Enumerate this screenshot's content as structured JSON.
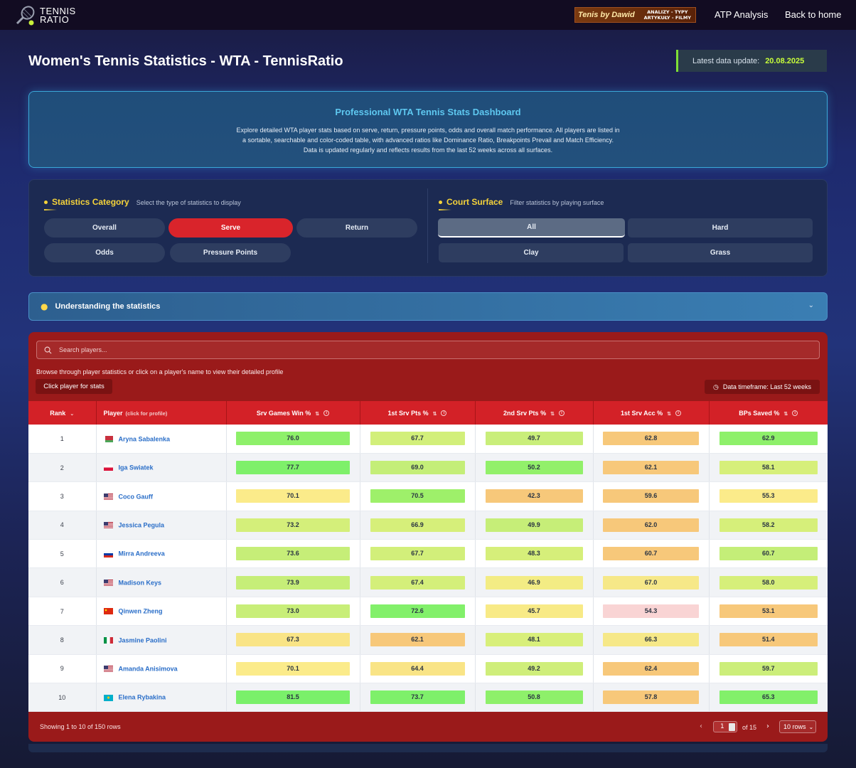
{
  "nav": {
    "brand_line1": "TENNIS",
    "brand_line2": "RATIO",
    "promo_main": "Tenis by Dawid",
    "promo_sub1": "ANALIZY - TYPY",
    "promo_sub2": "ARTYKUŁY - FILMY",
    "link_atp": "ATP Analysis",
    "link_home": "Back to home"
  },
  "page": {
    "title": "Women's Tennis Statistics - WTA - TennisRatio",
    "update_label": "Latest data update:",
    "update_value": "20.08.2025"
  },
  "hero": {
    "heading": "Professional WTA Tennis Stats Dashboard",
    "text": "Explore detailed WTA player stats based on serve, return, pressure points, odds and overall match performance. All players are listed in a sortable, searchable and color-coded table, with advanced ratios like Dominance Ratio, Breakpoints Prevail and Match Efficiency. Data is updated regularly and reflects results from the last 52 weeks across all surfaces."
  },
  "filters": {
    "category_title": "Statistics Category",
    "category_sub": "Select the type of statistics to display",
    "categories": [
      "Overall",
      "Serve",
      "Return",
      "Odds",
      "Pressure Points"
    ],
    "active_category": "Serve",
    "surface_title": "Court Surface",
    "surface_sub": "Filter statistics by playing surface",
    "surfaces": [
      "All",
      "Hard",
      "Clay",
      "Grass"
    ],
    "active_surface": "All"
  },
  "accordion": {
    "label": "Understanding the statistics"
  },
  "table": {
    "search_placeholder": "Search players...",
    "browse_text": "Browse through player statistics or click on a player's name to view their detailed profile",
    "click_button": "Click player for stats",
    "timeframe": "Data timeframe: Last 52 weeks",
    "columns": {
      "rank": "Rank",
      "player": "Player",
      "player_hint": "(click for profile)",
      "c1": "Srv Games Win %",
      "c2": "1st Srv Pts %",
      "c3": "2nd Srv Pts %",
      "c4": "1st Srv Acc %",
      "c5": "BPs Saved %"
    },
    "rows": [
      {
        "rank": "1",
        "player": "Aryna Sabalenka",
        "flag": "blr",
        "v": [
          "76.0",
          "67.7",
          "49.7",
          "62.8",
          "62.9"
        ],
        "c": [
          "#8ef06a",
          "#d2ef7a",
          "#c9ee7a",
          "#f7c87a",
          "#8ef06a"
        ]
      },
      {
        "rank": "2",
        "player": "Iga Swiatek",
        "flag": "pol",
        "v": [
          "77.7",
          "69.0",
          "50.2",
          "62.1",
          "58.1"
        ],
        "c": [
          "#7ef06a",
          "#c4ee78",
          "#92f06a",
          "#f7c87a",
          "#d6ef7a"
        ]
      },
      {
        "rank": "3",
        "player": "Coco Gauff",
        "flag": "usa",
        "v": [
          "70.1",
          "70.5",
          "42.3",
          "59.6",
          "55.3"
        ],
        "c": [
          "#fbeb8a",
          "#9ef06a",
          "#f7c87a",
          "#f7c87a",
          "#fbeb8a"
        ]
      },
      {
        "rank": "4",
        "player": "Jessica Pegula",
        "flag": "usa",
        "v": [
          "73.2",
          "66.9",
          "49.9",
          "62.0",
          "58.2"
        ],
        "c": [
          "#d4ef7a",
          "#d6ef7a",
          "#c6ee78",
          "#f7c87a",
          "#d6ef7a"
        ]
      },
      {
        "rank": "5",
        "player": "Mirra Andreeva",
        "flag": "rus",
        "v": [
          "73.6",
          "67.7",
          "48.3",
          "60.7",
          "60.7"
        ],
        "c": [
          "#c6ee78",
          "#d2ef7a",
          "#d6ef7a",
          "#f7c87a",
          "#c4ee78"
        ]
      },
      {
        "rank": "6",
        "player": "Madison Keys",
        "flag": "usa",
        "v": [
          "73.9",
          "67.4",
          "46.9",
          "67.0",
          "58.0"
        ],
        "c": [
          "#c6ee78",
          "#d4ef7a",
          "#f3ec84",
          "#f6e888",
          "#d6ef7a"
        ]
      },
      {
        "rank": "7",
        "player": "Qinwen Zheng",
        "flag": "chn",
        "v": [
          "73.0",
          "72.6",
          "45.7",
          "54.3",
          "53.1"
        ],
        "c": [
          "#c8ee78",
          "#82f06a",
          "#f8ea86",
          "#f9d4d4",
          "#f7c87a"
        ]
      },
      {
        "rank": "8",
        "player": "Jasmine Paolini",
        "flag": "ita",
        "v": [
          "67.3",
          "62.1",
          "48.1",
          "66.3",
          "51.4"
        ],
        "c": [
          "#f9e486",
          "#f7c87a",
          "#d8ef7a",
          "#f6e888",
          "#f7c87a"
        ]
      },
      {
        "rank": "9",
        "player": "Amanda Anisimova",
        "flag": "usa",
        "v": [
          "70.1",
          "64.4",
          "49.2",
          "62.4",
          "59.7"
        ],
        "c": [
          "#fbeb8a",
          "#f9e486",
          "#cfee7a",
          "#f7c87a",
          "#ccee7a"
        ]
      },
      {
        "rank": "10",
        "player": "Elena Rybakina",
        "flag": "kaz",
        "v": [
          "81.5",
          "73.7",
          "50.8",
          "57.8",
          "65.3"
        ],
        "c": [
          "#7af06a",
          "#7ef06a",
          "#8ef06a",
          "#f7c87a",
          "#82f06a"
        ]
      }
    ],
    "footer_text": "Showing 1 to 10 of 150 rows",
    "page_current": "1",
    "page_total": "of 15",
    "rows_per_page": "10 rows"
  }
}
